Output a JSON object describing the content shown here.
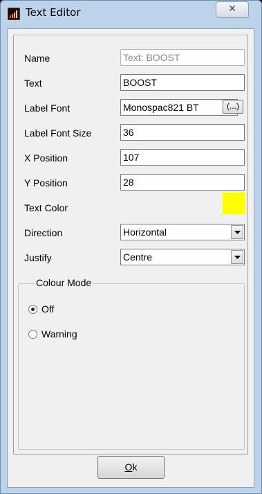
{
  "window": {
    "title": "Text Editor",
    "app_icon": "chart-bars-icon",
    "close_icon": "close-icon",
    "close_glyph": "✕"
  },
  "fields": {
    "name": {
      "label": "Name",
      "value": "Text: BOOST"
    },
    "text": {
      "label": "Text",
      "value": "BOOST"
    },
    "label_font": {
      "label": "Label Font",
      "value": "Monospac821 BT",
      "browse_label": "(...)"
    },
    "label_font_size": {
      "label": "Label Font Size",
      "value": "36"
    },
    "x_position": {
      "label": "X Position",
      "value": "107"
    },
    "y_position": {
      "label": "Y Position",
      "value": "28"
    },
    "text_color": {
      "label": "Text Color",
      "color": "#ffff00"
    },
    "direction": {
      "label": "Direction",
      "value": "Horizontal"
    },
    "justify": {
      "label": "Justify",
      "value": "Centre"
    }
  },
  "colour_mode": {
    "title": "Colour Mode",
    "options": [
      {
        "label": "Off",
        "selected": true
      },
      {
        "label": "Warning",
        "selected": false
      }
    ]
  },
  "ok_button": {
    "mnemonic": "O",
    "rest": "k"
  }
}
